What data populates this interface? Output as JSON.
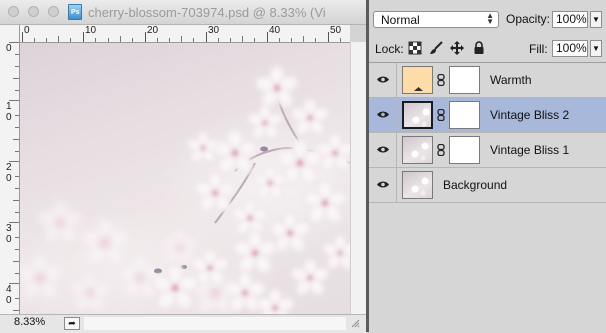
{
  "document": {
    "title": "cherry-blossom-703974.psd @ 8.33% (Vi",
    "file_badge": "Ps",
    "zoom": "8.33%",
    "ruler_h_labels": [
      "0",
      "10",
      "20",
      "30",
      "40",
      "50"
    ],
    "ruler_v_labels": [
      [
        "0"
      ],
      [
        "1",
        "0"
      ],
      [
        "2",
        "0"
      ],
      [
        "3",
        "0"
      ],
      [
        "4",
        "0"
      ]
    ]
  },
  "layers_panel": {
    "blend_mode": "Normal",
    "opacity_label": "Opacity:",
    "opacity_value": "100%",
    "lock_label": "Lock:",
    "fill_label": "Fill:",
    "fill_value": "100%",
    "layers": [
      {
        "name": "Warmth",
        "selected": false,
        "thumb": "warm-fill",
        "has_mask": true
      },
      {
        "name": "Vintage Bliss 2",
        "selected": true,
        "thumb": "photo",
        "has_mask": true
      },
      {
        "name": "Vintage Bliss 1",
        "selected": false,
        "thumb": "photo",
        "has_mask": true
      },
      {
        "name": "Background",
        "selected": false,
        "thumb": "photo",
        "has_mask": false
      }
    ],
    "selection_color": "#a7b8da",
    "warmth_color": "#fedca9"
  }
}
